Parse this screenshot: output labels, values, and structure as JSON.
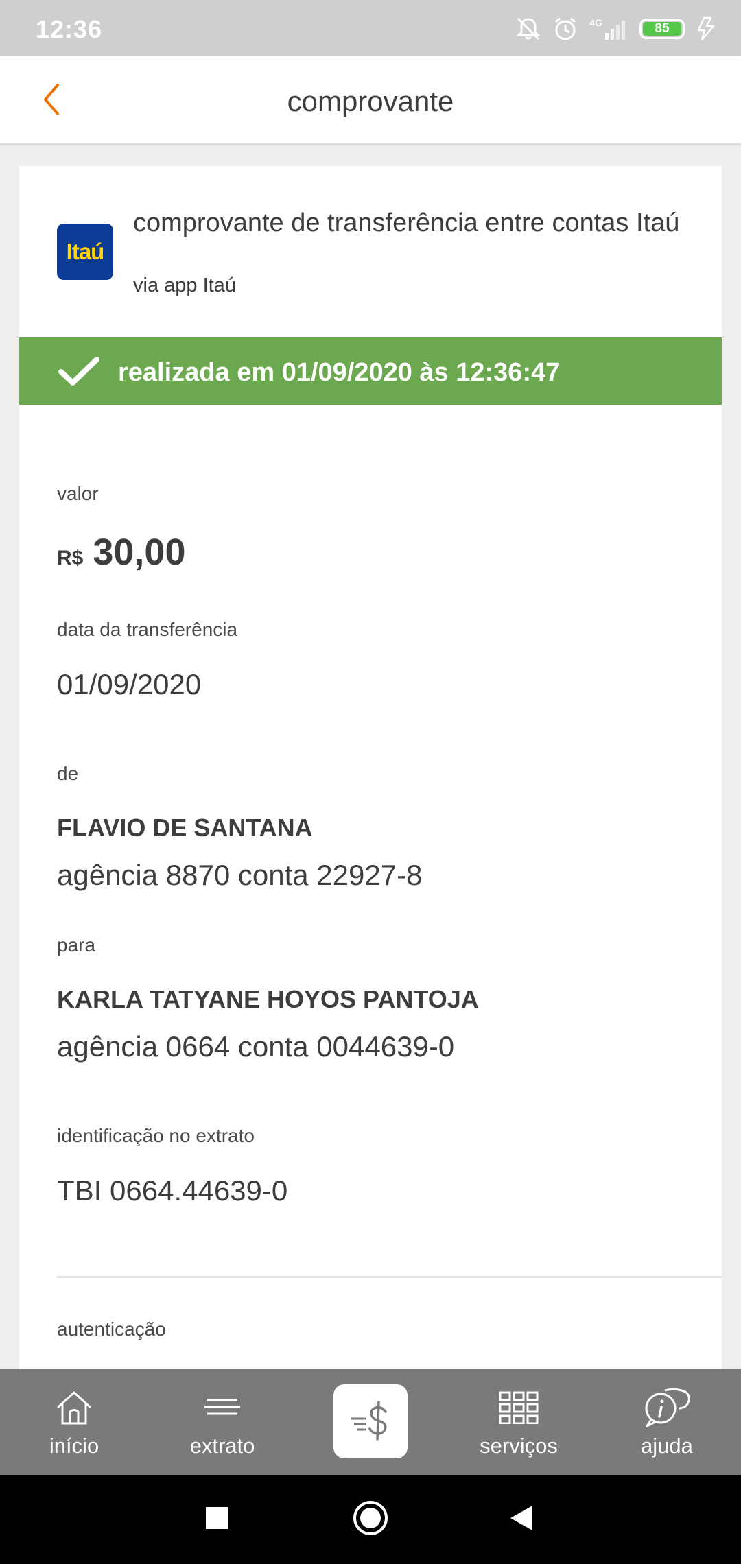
{
  "status_bar": {
    "time": "12:36",
    "network_label": "4G",
    "battery_level": "85",
    "icons": [
      "notifications-off-icon",
      "alarm-icon",
      "signal-icon",
      "battery-icon",
      "charging-icon"
    ]
  },
  "header": {
    "title": "comprovante",
    "back_icon": "chevron-left-icon"
  },
  "receipt": {
    "logo_text": "Itaú",
    "title": "comprovante de transferência entre contas Itaú",
    "subtitle": "via app Itaú",
    "status_text": "realizada em 01/09/2020 às 12:36:47",
    "valor_label": "valor",
    "currency": "R$",
    "amount": "30,00",
    "date_label": "data da transferência",
    "date_value": "01/09/2020",
    "from_label": "de",
    "from_name": "FLAVIO DE SANTANA",
    "from_account": "agência 8870 conta 22927-8",
    "to_label": "para",
    "to_name": "KARLA TATYANE HOYOS PANTOJA",
    "to_account": "agência 0664 conta 0044639-0",
    "statement_id_label": "identificação no extrato",
    "statement_id_value": "TBI 0664.44639-0",
    "auth_label": "autenticação"
  },
  "bottom_nav": {
    "items": [
      {
        "label": "início",
        "icon": "home-icon"
      },
      {
        "label": "extrato",
        "icon": "statement-icon"
      },
      {
        "label": "",
        "icon": "transfer-money-icon"
      },
      {
        "label": "serviços",
        "icon": "grid-icon"
      },
      {
        "label": "ajuda",
        "icon": "help-chat-icon"
      }
    ]
  },
  "colors": {
    "accent_orange": "#ec7000",
    "success_green": "#6ba84f",
    "itau_blue": "#0b3b95",
    "itau_yellow": "#ffd400",
    "nav_gray": "#7a7a7a"
  }
}
